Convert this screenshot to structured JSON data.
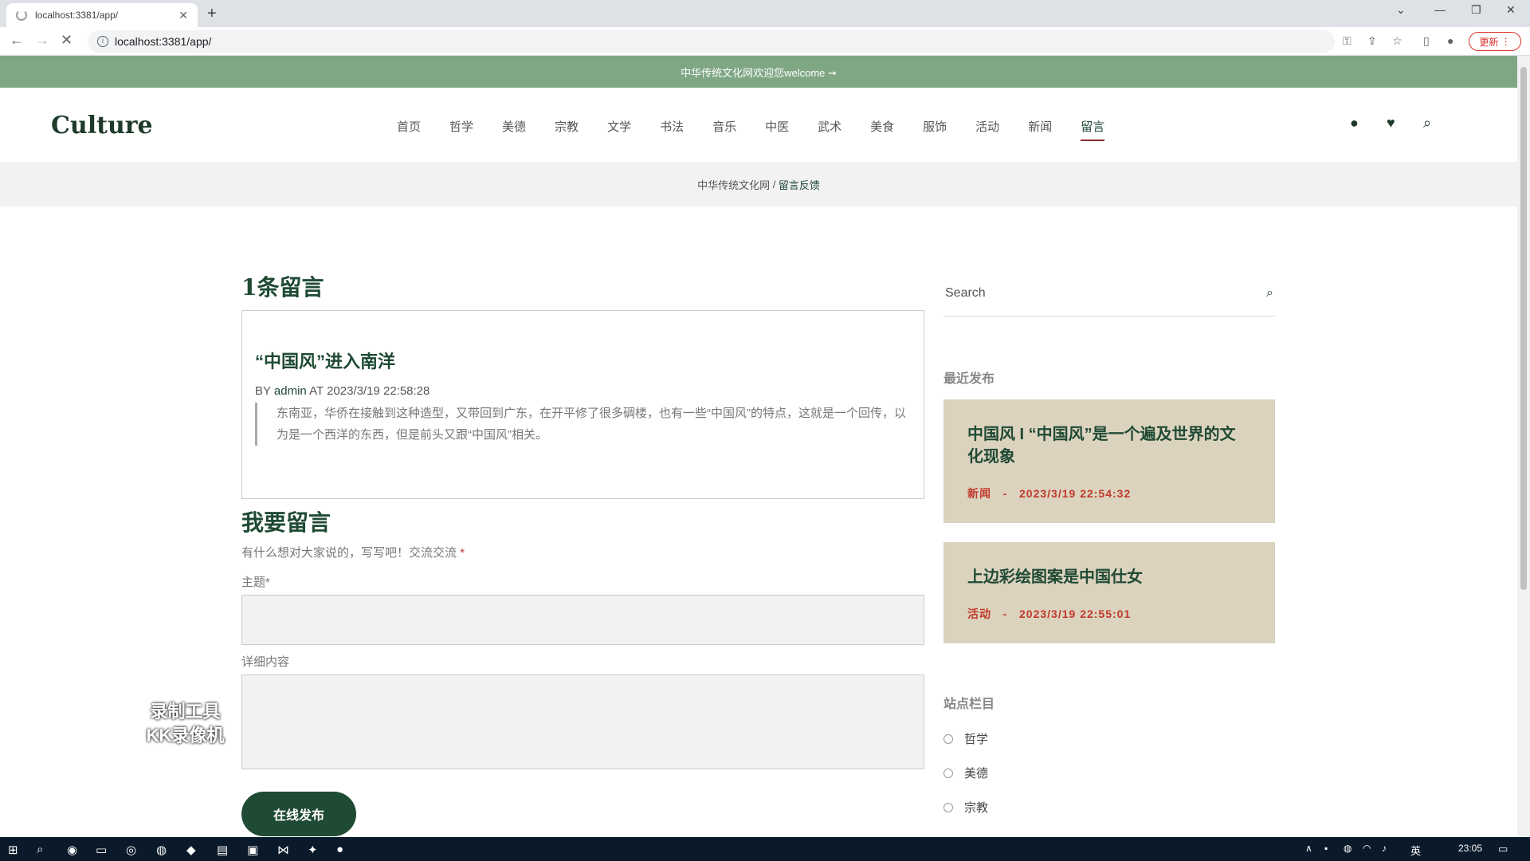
{
  "browser": {
    "tab_title": "localhost:3381/app/",
    "url": "localhost:3381/app/",
    "update_label": "更新"
  },
  "site": {
    "top_banner": "中华传统文化网欢迎您welcome ➞",
    "logo": "Culture",
    "nav": [
      "首页",
      "哲学",
      "美德",
      "宗教",
      "文学",
      "书法",
      "音乐",
      "中医",
      "武术",
      "美食",
      "服饰",
      "活动",
      "新闻",
      "留言"
    ],
    "active_nav": "留言"
  },
  "breadcrumb": {
    "home": "中华传统文化网",
    "sep": " / ",
    "current": "留言反馈"
  },
  "comments": {
    "count_title": "1条留言",
    "items": [
      {
        "title": "“中国风”进入南洋",
        "by": "BY",
        "author": "admin",
        "at": "AT 2023/3/19 22:58:28",
        "body": "东南亚，华侨在接触到这种造型，又带回到广东，在开平修了很多碉楼，也有一些“中国风”的特点，这就是一个回传，以为是一个西洋的东西，但是前头又跟“中国风”相关。"
      }
    ]
  },
  "form": {
    "title": "我要留言",
    "subtitle": "有什么想对大家说的，写写吧！交流交流",
    "required_mark": "*",
    "subject_label": "主题*",
    "detail_label": "详细内容",
    "submit_label": "在线发布"
  },
  "sidebar": {
    "search_placeholder": "Search",
    "recent_title": "最近发布",
    "recent": [
      {
        "title": "中国风 I “中国风”是一个遍及世界的文化现象",
        "category": "新闻",
        "sep": "-",
        "date": "2023/3/19 22:54:32"
      },
      {
        "title": "上边彩绘图案是中国仕女",
        "category": "活动",
        "sep": "-",
        "date": "2023/3/19 22:55:01"
      }
    ],
    "categories_title": "站点栏目",
    "categories": [
      "哲学",
      "美德",
      "宗教"
    ]
  },
  "watermark": {
    "line1": "录制工具",
    "line2": "KK录像机"
  },
  "taskbar": {
    "ime": "英",
    "time": "23:05"
  }
}
